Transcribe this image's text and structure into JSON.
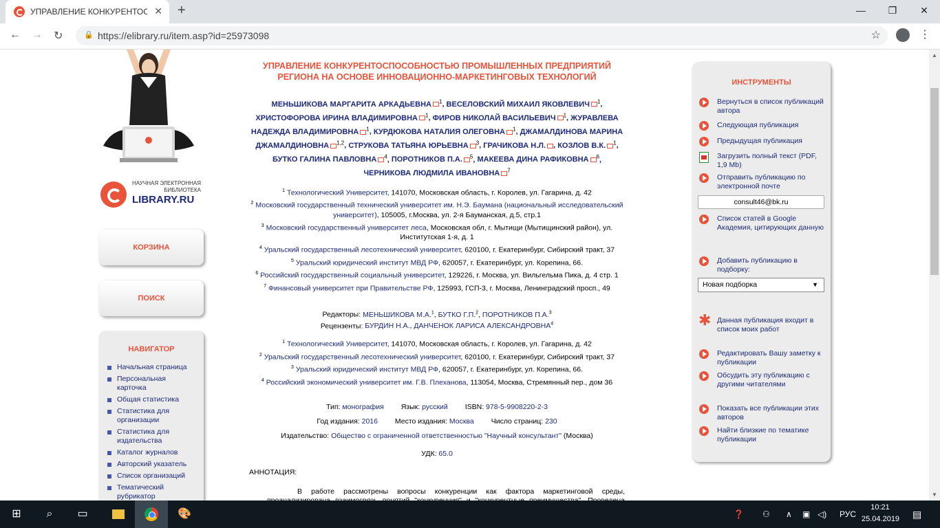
{
  "browser": {
    "tab_title": "УПРАВЛЕНИЕ КОНКУРЕНТОСПО",
    "tab_close": "✕",
    "new_tab": "+",
    "url": "https://elibrary.ru/item.asp?id=25973098",
    "window_controls": [
      "—",
      "❐",
      "✕"
    ]
  },
  "logo": {
    "line1": "НАУЧНАЯ ЭЛЕКТРОННАЯ БИБЛИОТЕКА",
    "name": "LIBRARY.RU"
  },
  "left": {
    "cart": "КОРЗИНА",
    "search": "ПОИСК",
    "navigator_title": "НАВИГАТОР",
    "nav_items": [
      "Начальная страница",
      "Персональная карточка",
      "Общая статистика",
      "Статистика для организации",
      "Статистика для издательства",
      "Каталог журналов",
      "Авторский указатель",
      "Список организаций",
      "Тематический рубрикатор"
    ]
  },
  "article": {
    "title": "УПРАВЛЕНИЕ КОНКУРЕНТОСПОСОБНОСТЬЮ ПРОМЫШЛЕННЫХ ПРЕДПРИЯТИЙ РЕГИОНА НА ОСНОВЕ ИННОВАЦИОННО-МАРКЕТИНГОВЫХ ТЕХНОЛОГИЙ",
    "authors": [
      {
        "name": "МЕНЬШИКОВА МАРГАРИТА АРКАДЬЕВНА",
        "sup": "1"
      },
      {
        "name": "ВЕСЕЛОВСКИЙ МИХАИЛ ЯКОВЛЕВИЧ",
        "sup": "1"
      },
      {
        "name": "ХРИСТОФОРОВА ИРИНА ВЛАДИМИРОВНА",
        "sup": "1"
      },
      {
        "name": "ФИРОВ НИКОЛАЙ ВАСИЛЬЕВИЧ",
        "sup": "1"
      },
      {
        "name": "ЖУРАВЛЕВА НАДЕЖДА ВЛАДИМИРОВНА",
        "sup": "1"
      },
      {
        "name": "КУРДЮКОВА НАТАЛИЯ ОЛЕГОВНА",
        "sup": "1"
      },
      {
        "name": "ДЖАМАЛДИНОВА МАРИНА ДЖАМАЛДИНОВНА",
        "sup": "1,2"
      },
      {
        "name": "СТРУКОВА ТАТЬЯНА ЮРЬЕВНА",
        "sup": "3"
      },
      {
        "name": "ГРАЧИКОВА Н.Л.",
        "sup": ""
      },
      {
        "name": "КОЗЛОВ В.К.",
        "sup": "1"
      },
      {
        "name": "БУТКО ГАЛИНА ПАВЛОВНА",
        "sup": "4"
      },
      {
        "name": "ПОРОТНИКОВ П.А.",
        "sup": "5"
      },
      {
        "name": "МАКЕЕВА ДИНА РАФИКОВНА",
        "sup": "6"
      },
      {
        "name": "ЧЕРНИКОВА ЛЮДМИЛА ИВАНОВНА",
        "sup": "7"
      }
    ],
    "affiliations": [
      {
        "n": "1",
        "org": "Технологический Университет",
        "addr": ", 141070, Московская область, г. Королев, ул. Гагарина, д. 42"
      },
      {
        "n": "2",
        "org": "Московский государственный технический университет им. Н.Э. Баумана (национальный исследовательский университет)",
        "addr": ", 105005, г.Москва, ул. 2-я Бауманская, д.5, стр.1"
      },
      {
        "n": "3",
        "org": "Московский государственный университет леса",
        "addr": ", Московская обл, г. Мытищи (Мытищинский район), ул. Институтская 1-я, д. 1"
      },
      {
        "n": "4",
        "org": "Уральский государственный лесотехнический университет",
        "addr": ", 620100, г. Екатеринбург, Сибирский тракт, 37"
      },
      {
        "n": "5",
        "org": "Уральский юридический институт МВД РФ",
        "addr": ", 620057, г. Екатеринбург, ул. Корепина, 66."
      },
      {
        "n": "6",
        "org": "Российский государственный социальный университет",
        "addr": ", 129226, г. Москва, ул. Вильгельма Пика, д. 4 стр. 1"
      },
      {
        "n": "7",
        "org": "Финансовый университет при Правительстве РФ",
        "addr": ", 125993, ГСП-3, г. Москва, Ленинградский просп., 49"
      }
    ],
    "editors_label": "Редакторы: ",
    "editors": [
      {
        "name": "МЕНЬШИКОВА М.А.",
        "sup": "1"
      },
      {
        "name": "БУТКО Г.П.",
        "sup": "2"
      },
      {
        "name": "ПОРОТНИКОВ П.А.",
        "sup": "3"
      }
    ],
    "reviewers_label": "Рецензенты: ",
    "reviewers": [
      {
        "name": "БУРДИН Н.А.",
        "sup": ""
      },
      {
        "name": "ДАНЧЕНОК ЛАРИСА АЛЕКСАНДРОВНА",
        "sup": "4"
      }
    ],
    "editor_affiliations": [
      {
        "n": "1",
        "org": "Технологический Университет",
        "addr": ", 141070, Московская область, г. Королев, ул. Гагарина, д. 42"
      },
      {
        "n": "2",
        "org": "Уральский государственный лесотехнический университет",
        "addr": ", 620100, г. Екатеринбург, Сибирский тракт, 37"
      },
      {
        "n": "3",
        "org": "Уральский юридический институт МВД РФ",
        "addr": ", 620057, г. Екатеринбург, ул. Корепина, 66."
      },
      {
        "n": "4",
        "org": "Российский экономический университет им. Г.В. Плеханова",
        "addr": ", 113054, Москва, Стремянный пер., дом 36"
      }
    ],
    "type_label": "Тип: ",
    "type": "монография",
    "lang_label": "Язык: ",
    "lang": "русский",
    "isbn_label": "ISBN: ",
    "isbn": "978-5-9908220-2-3",
    "year_label": "Год издания: ",
    "year": "2016",
    "place_label": "Место издания: ",
    "place": "Москва",
    "pages_label": "Число страниц: ",
    "pages": "230",
    "publisher_label": "Издательство: ",
    "publisher": "Общество с ограниченной ответственностью \"Научный консультант\"",
    "publisher_city": " (Москва)",
    "udk_label": "УДК: ",
    "udk": "65.0",
    "annotation_label": "АННОТАЦИЯ:",
    "annotation": "В работе рассмотрены вопросы конкуренции как фактора маркетинговой среды, проанализирована взаимосвязь понятий \"конкуренция\" и \"конкурентные преимущества\". Проведена оценка развития лесопромышленного комплекса и представлен механизм управления"
  },
  "tools": {
    "title": "ИНСТРУМЕНТЫ",
    "back_to_list": "Вернуться в список публикаций автора",
    "next": "Следующая публикация",
    "prev": "Предыдущая публикация",
    "download": "Загрузить полный текст (PDF, 1,9 Mb)",
    "send_email": "Отправить публикацию по электронной почте",
    "email_value": "consult46@bk.ru",
    "google": "Список статей в Google Академия, цитирующих данную",
    "add_collection": "Добавить публикацию в подборку:",
    "collection_selected": "Новая подборка",
    "in_my_works": "Данная публикация входит в список моих работ",
    "edit_note": "Редактировать Вашу заметку к публикации",
    "discuss": "Обсудить эту публикацию с другими читателями",
    "show_all": "Показать все публикации этих авторов",
    "similar": "Найти близкие по тематике публикации"
  },
  "taskbar": {
    "lang": "РУС",
    "time": "10:21",
    "date": "25.04.2019"
  }
}
